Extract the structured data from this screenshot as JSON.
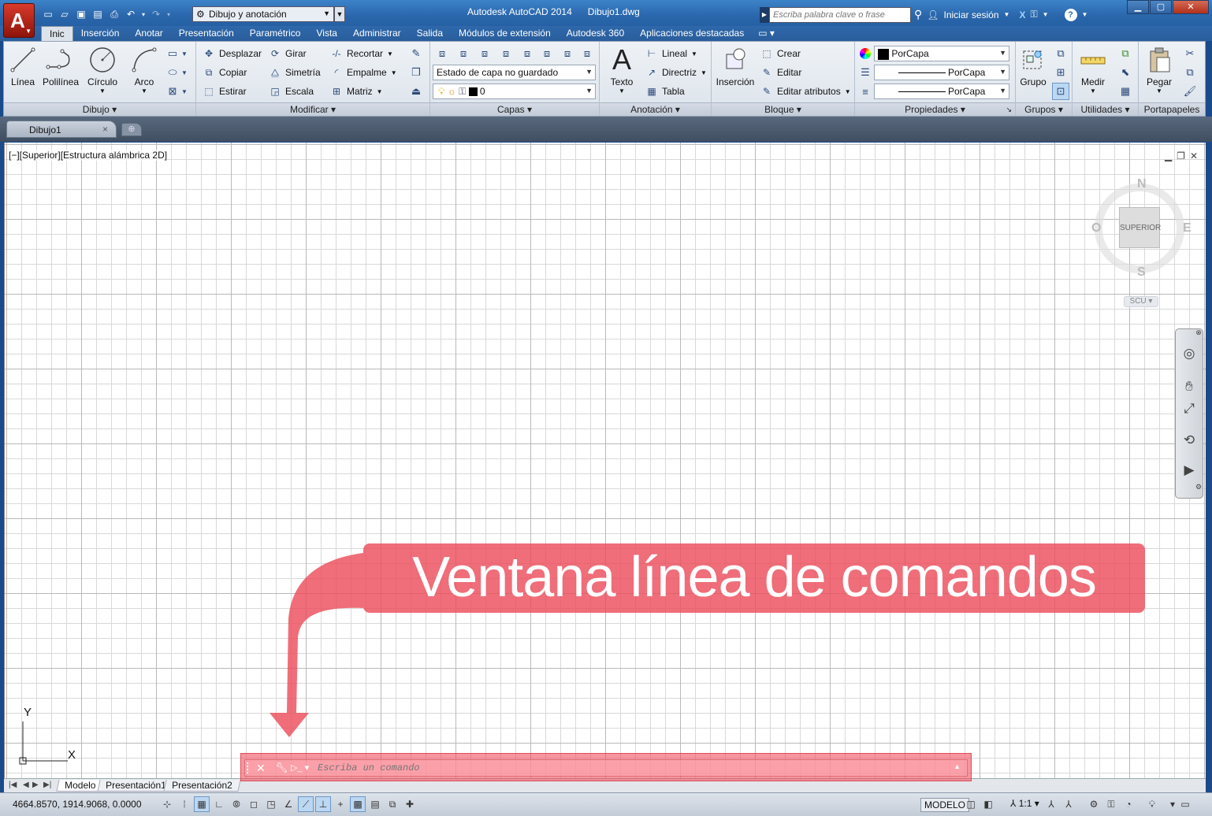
{
  "window": {
    "title": "Autodesk AutoCAD 2014",
    "document_name": "Dibujo1.dwg",
    "workspace": "Dibujo y anotación",
    "search_placeholder": "Escriba palabra clave o frase",
    "signin_label": "Iniciar sesión",
    "help_label": "?",
    "minimize": "▁",
    "maximize": "▢",
    "close": "✕"
  },
  "app_menu": {
    "logo": "A"
  },
  "menu_tabs": [
    "Inic",
    "Inserción",
    "Anotar",
    "Presentación",
    "Paramétrico",
    "Vista",
    "Administrar",
    "Salida",
    "Módulos de extensión",
    "Autodesk 360",
    "Aplicaciones destacadas"
  ],
  "ribbon": {
    "dibujo": {
      "title": "Dibujo",
      "tools": [
        "Línea",
        "Polilínea",
        "Círculo",
        "Arco"
      ]
    },
    "modificar": {
      "title": "Modificar",
      "tools": [
        "Desplazar",
        "Girar",
        "Recortar",
        "Copiar",
        "Simetría",
        "Empalme",
        "Estirar",
        "Escala",
        "Matriz"
      ]
    },
    "capas": {
      "title": "Capas",
      "layer_state": "Estado de capa no guardado",
      "current_layer": "0"
    },
    "anotacion": {
      "title": "Anotación",
      "big_tool": "Texto",
      "tools": [
        "Lineal",
        "Directriz",
        "Tabla"
      ]
    },
    "bloque": {
      "title": "Bloque",
      "big_tool": "Inserción",
      "tools": [
        "Crear",
        "Editar",
        "Editar atributos"
      ]
    },
    "propiedades": {
      "title": "Propiedades",
      "color": "PorCapa",
      "linetype": "PorCapa",
      "lineweight": "PorCapa"
    },
    "grupos": {
      "title": "Grupos",
      "big_tool": "Grupo"
    },
    "utilidades": {
      "title": "Utilidades",
      "big_tool": "Medir"
    },
    "portapapeles": {
      "title": "Portapapeles",
      "big_tool": "Pegar"
    }
  },
  "document_tab": {
    "name": "Dibujo1",
    "close": "×"
  },
  "viewport": {
    "label": "[−][Superior][Estructura alámbrica 2D]",
    "viewcube": {
      "north": "N",
      "south": "S",
      "east": "E",
      "west": "O",
      "face": "SUPERIOR",
      "ucs": "SCU"
    }
  },
  "ucs_icon": {
    "x": "X",
    "y": "Y"
  },
  "callout": {
    "text": "Ventana línea de comandos"
  },
  "command_line": {
    "placeholder": "Escriba un comando"
  },
  "layout_tabs": [
    "Modelo",
    "Presentación1",
    "Presentación2"
  ],
  "status_bar": {
    "coordinates": "4664.8570, 1914.9068, 0.0000",
    "space": "MODELO",
    "annotation_scale": "1:1"
  },
  "colors": {
    "titlebar": "#2a66ab",
    "callout": "#ec4e5c",
    "grid_major": "#b9b9b9",
    "grid_minor": "#d9d9d9",
    "app_logo": "#c0281c"
  }
}
